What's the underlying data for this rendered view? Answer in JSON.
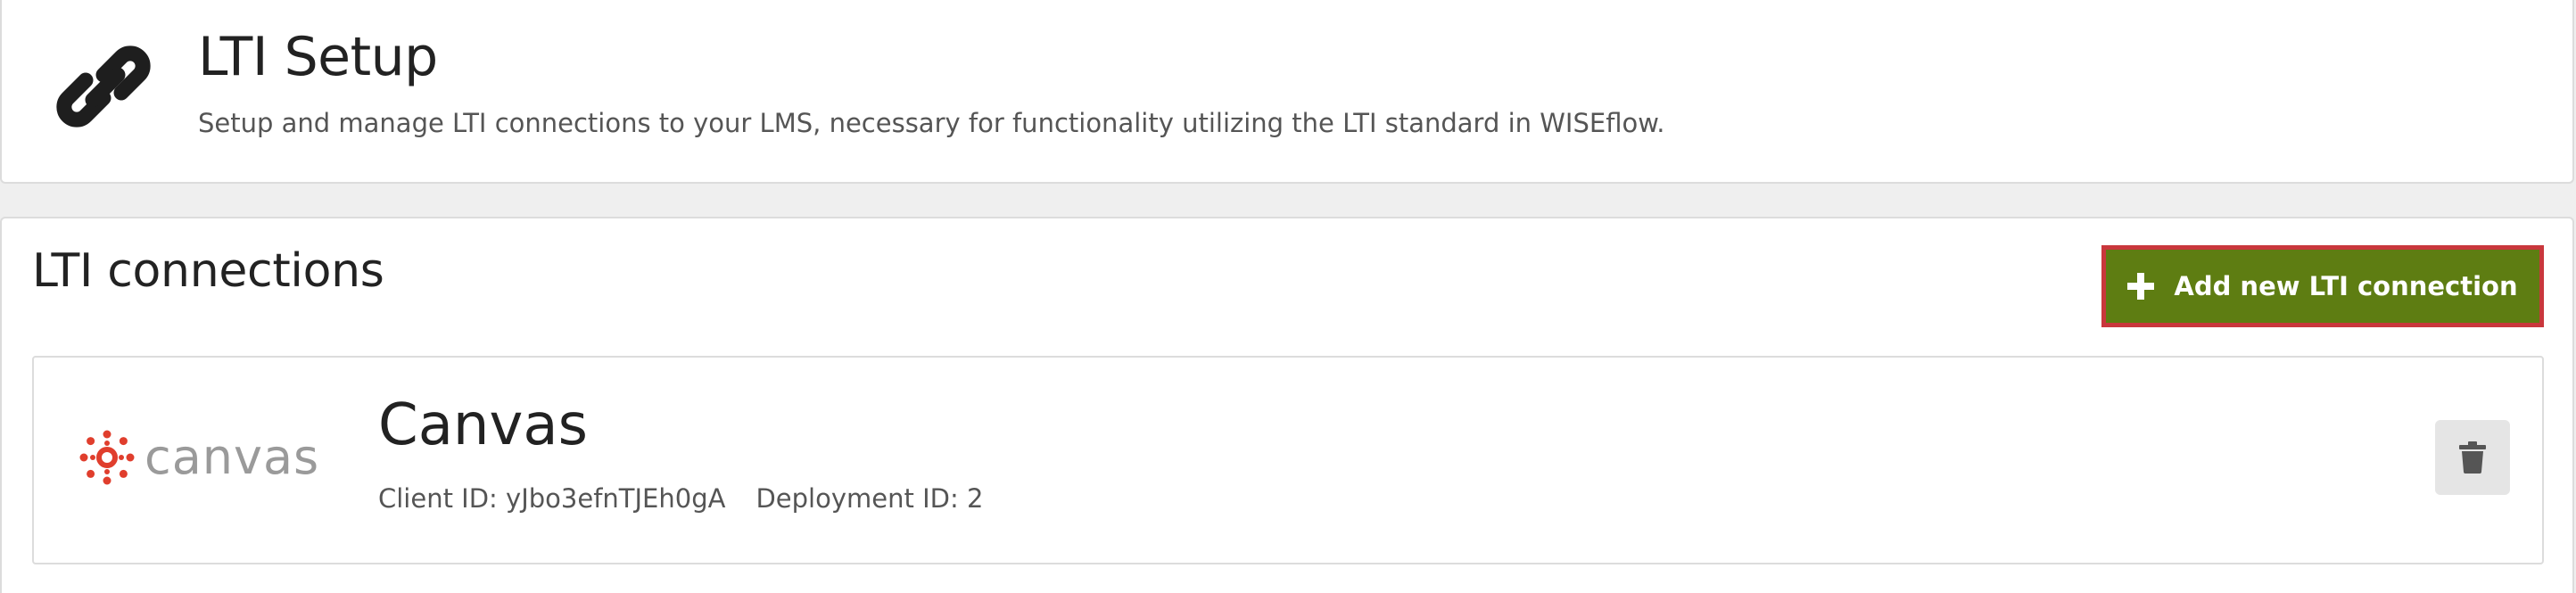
{
  "header": {
    "title": "LTI Setup",
    "subtitle": "Setup and manage LTI connections to your LMS, necessary for functionality utilizing the LTI standard in WISEflow.",
    "icon": "link-icon"
  },
  "connections": {
    "title": "LTI connections",
    "add_button_label": "Add new LTI connection",
    "add_button_icon": "plus-icon",
    "items": [
      {
        "logo_text": "canvas",
        "name": "Canvas",
        "client_id_label": "Client ID:",
        "client_id": "yJbo3efnTJEh0gA",
        "deployment_id_label": "Deployment ID:",
        "deployment_id": "2",
        "delete_icon": "trash-icon"
      }
    ]
  },
  "colors": {
    "accent_green": "#5e7d12",
    "highlight_red": "#c9373c",
    "canvas_red": "#e03e2d"
  }
}
